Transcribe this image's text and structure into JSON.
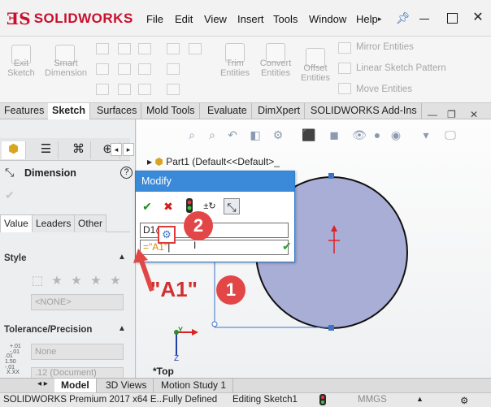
{
  "app": {
    "logo_ds": "ƎS",
    "logo_brand": "SOLIDWORKS"
  },
  "menu": [
    "File",
    "Edit",
    "View",
    "Insert",
    "Tools",
    "Window",
    "Help"
  ],
  "ribbon": {
    "exit_sketch": "Exit Sketch",
    "smart_dimension": "Smart Dimension",
    "trim_entities": "Trim Entities",
    "convert_entities": "Convert Entities",
    "offset_entities": "Offset Entities",
    "mirror_entities": "Mirror Entities",
    "linear_sketch_pattern": "Linear Sketch Pattern",
    "move_entities": "Move Entities"
  },
  "command_tabs": [
    "Features",
    "Sketch",
    "Surfaces",
    "Mold Tools",
    "Evaluate",
    "DimXpert",
    "SOLIDWORKS Add-Ins"
  ],
  "property_manager": {
    "title": "Dimension",
    "subtabs": [
      "Value",
      "Leaders",
      "Other"
    ],
    "style_title": "Style",
    "style_value": "<NONE>",
    "tolerance_title": "Tolerance/Precision",
    "tolerance_value": "None",
    "precision_value": ".12 (Document)",
    "tol_icon_1": "+.01\n-.01",
    "tol_icon_2": ".01\n1.50\n-.01",
    "tol_icon_3": "X.XX"
  },
  "graphics": {
    "tree_part": "Part1  (Default<<Default>_",
    "view_label": "*Top",
    "axis_y": "Y",
    "axis_z": "Z"
  },
  "modify": {
    "title": "Modify",
    "dimension_name": "D1@",
    "dimension_name_tail": "h1",
    "input_value": "=\"A1\"",
    "input_prefix": "="
  },
  "annotations": {
    "callout_1": "1",
    "callout_2": "2",
    "a1_label": "\"A1\""
  },
  "bottom_tabs": [
    "Model",
    "3D Views",
    "Motion Study 1"
  ],
  "status": {
    "product": "SOLIDWORKS Premium 2017 x64 E...",
    "state": "Fully Defined",
    "editing": "Editing Sketch1",
    "units": "MMGS"
  },
  "colors": {
    "accent_blue": "#3b8ad9",
    "callout_red": "#e34646",
    "circle_fill": "#a9aed6",
    "brand_red": "#c8102e"
  }
}
